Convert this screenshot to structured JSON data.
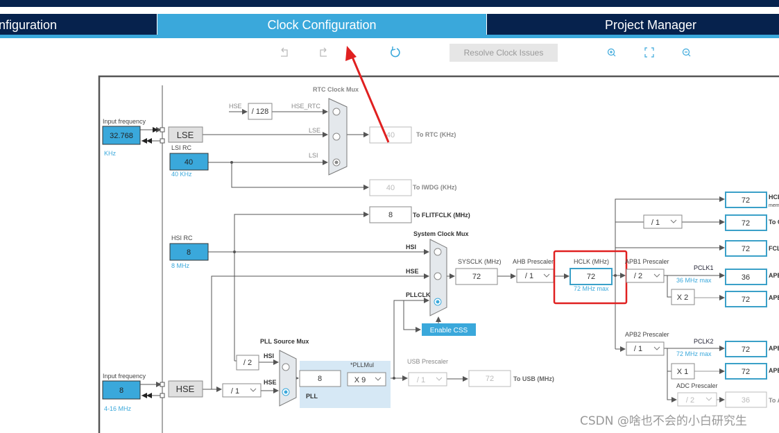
{
  "tabs": [
    {
      "label": "nfiguration",
      "active": false
    },
    {
      "label": "Clock Configuration",
      "active": true
    },
    {
      "label": "Project Manager",
      "active": false
    }
  ],
  "toolbar": {
    "undo_icon": "undo-icon",
    "redo_icon": "redo-icon",
    "reset_icon": "refresh-icon",
    "resolve_label": "Resolve Clock Issues",
    "zoom_in_icon": "zoom-in-icon",
    "fit_icon": "fit-screen-icon",
    "zoom_out_icon": "zoom-out-icon"
  },
  "colors": {
    "navy": "#06224d",
    "accent": "#3aa8db",
    "highlight": "#e02020"
  },
  "lse": {
    "input_label": "Input frequency",
    "value": "32.768",
    "unit": "KHz",
    "block": "LSE"
  },
  "lsi": {
    "label": "LSI RC",
    "value": "40",
    "unit": "40 KHz"
  },
  "rtc": {
    "mux_label": "RTC Clock Mux",
    "hse_label": "HSE",
    "div128": "/ 128",
    "hse_rtc": "HSE_RTC",
    "lse_label": "LSE",
    "lsi_label": "LSI",
    "out_value": "40",
    "out_label": "To RTC (KHz)"
  },
  "iwdg": {
    "value": "40",
    "label": "To IWDG (KHz)"
  },
  "flitf": {
    "value": "8",
    "label": "To FLITFCLK (MHz)"
  },
  "hsi": {
    "label": "HSI RC",
    "value": "8",
    "unit": "8 MHz"
  },
  "sysmux": {
    "label": "System Clock Mux",
    "hsi": "HSI",
    "hse": "HSE",
    "pllclk": "PLLCLK",
    "css": "Enable CSS"
  },
  "sysclk": {
    "label": "SYSCLK (MHz)",
    "value": "72"
  },
  "ahb": {
    "label": "AHB Prescaler",
    "value": "/ 1"
  },
  "hclk": {
    "label": "HCLK (MHz)",
    "value": "72",
    "max": "72 MHz max"
  },
  "outputs_top": [
    {
      "value": "72",
      "label": "HCL",
      "label2": "mem"
    },
    {
      "div": "/ 1",
      "value": "72",
      "label": "To C"
    },
    {
      "value": "72",
      "label": "FCL"
    }
  ],
  "apb1": {
    "label": "APB1 Prescaler",
    "value": "/ 2",
    "pclk": "PCLK1",
    "max": "36 MHz max",
    "out": "36",
    "out_label": "APB",
    "mult": "X 2",
    "timer_out": "72",
    "timer_label": "APB"
  },
  "apb2": {
    "label": "APB2 Prescaler",
    "value": "/ 1",
    "pclk": "PCLK2",
    "max": "72 MHz max",
    "out": "72",
    "out_label": "APB",
    "mult": "X 1",
    "timer_out": "72",
    "timer_label": "APB"
  },
  "adc": {
    "label": "ADC Prescaler",
    "value": "/ 2",
    "out": "36",
    "out_label": "To A"
  },
  "pll": {
    "src_label": "PLL Source Mux",
    "hsi": "HSI",
    "hse": "HSE",
    "div2": "/ 2",
    "in_value": "8",
    "mul_label": "*PLLMul",
    "mul": "X 9",
    "block": "PLL"
  },
  "usb": {
    "label": "USB Prescaler",
    "value": "/ 1",
    "out": "72",
    "out_label": "To USB (MHz)"
  },
  "hse": {
    "input_label": "Input frequency",
    "value": "8",
    "range": "4-16 MHz",
    "block": "HSE",
    "div": "/ 1"
  },
  "watermark": "CSDN @啥也不会的小白研究生"
}
